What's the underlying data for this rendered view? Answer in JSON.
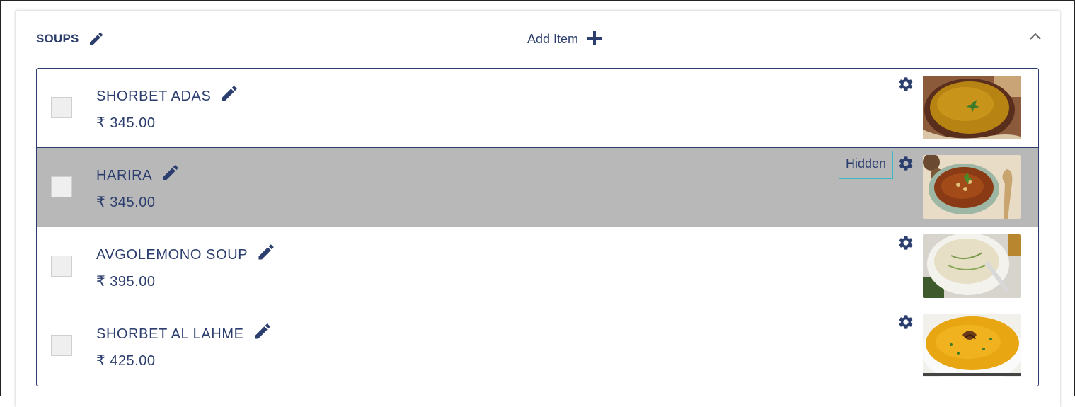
{
  "category": {
    "title": "SOUPS",
    "add_item_label": "Add Item"
  },
  "items": [
    {
      "name": "SHORBET ADAS",
      "price": "₹ 345.00",
      "hidden": false,
      "badge": ""
    },
    {
      "name": "HARIRA",
      "price": "₹ 345.00",
      "hidden": true,
      "badge": "Hidden"
    },
    {
      "name": "AVGOLEMONO SOUP",
      "price": "₹ 395.00",
      "hidden": false,
      "badge": ""
    },
    {
      "name": "SHORBET AL LAHME",
      "price": "₹ 425.00",
      "hidden": false,
      "badge": ""
    }
  ],
  "colors": {
    "primary": "#2c3e6e",
    "hidden_row_bg": "#b8b8b8",
    "badge_border": "#3fb7c4"
  }
}
